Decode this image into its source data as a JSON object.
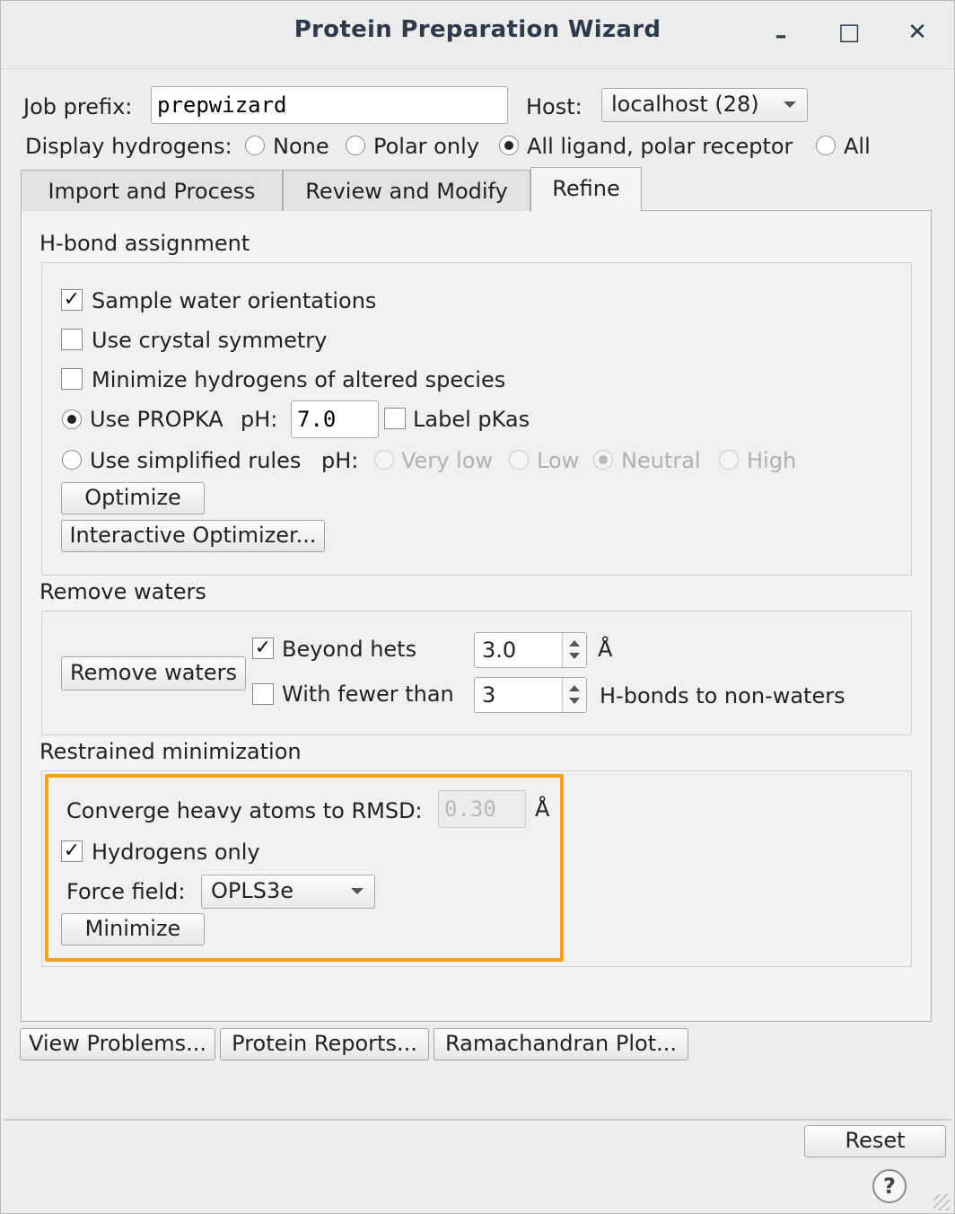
{
  "window": {
    "title": "Protein Preparation Wizard",
    "minimize_glyph": "–",
    "maximize_glyph": "□",
    "close_glyph": "✕"
  },
  "job": {
    "prefix_label": "Job prefix:",
    "prefix_value": "prepwizard",
    "host_label": "Host:",
    "host_value": "localhost (28)"
  },
  "display_hydrogens": {
    "label": "Display hydrogens:",
    "options": [
      "None",
      "Polar only",
      "All ligand, polar receptor",
      "All"
    ],
    "selected": "All ligand, polar receptor"
  },
  "tabs": [
    {
      "label": "Import and Process",
      "active": false
    },
    {
      "label": "Review and Modify",
      "active": false
    },
    {
      "label": "Refine",
      "active": true
    }
  ],
  "hbond": {
    "section_title": "H-bond assignment",
    "sample_water": {
      "label": "Sample water orientations",
      "checked": true
    },
    "crystal_symmetry": {
      "label": "Use crystal symmetry",
      "checked": false
    },
    "minimize_hydrogens": {
      "label": "Minimize hydrogens of altered species",
      "checked": false
    },
    "propka": {
      "label": "Use PROPKA",
      "selected": true,
      "ph_label": "pH:",
      "ph_value": "7.0"
    },
    "label_pkas": {
      "label": "Label pKas",
      "checked": false
    },
    "simplified": {
      "label": "Use simplified rules",
      "selected": false,
      "ph_label": "pH:"
    },
    "ph_options": [
      "Very low",
      "Low",
      "Neutral",
      "High"
    ],
    "ph_selected": "Neutral",
    "optimize_button": "Optimize",
    "interactive_button": "Interactive Optimizer..."
  },
  "waters": {
    "section_title": "Remove waters",
    "remove_button": "Remove waters",
    "beyond_hets": {
      "label": "Beyond hets",
      "checked": true,
      "value": "3.0",
      "unit": "Å"
    },
    "fewer_than": {
      "label": "With fewer than",
      "checked": false,
      "value": "3",
      "suffix": "H-bonds to non-waters"
    }
  },
  "minimization": {
    "section_title": "Restrained minimization",
    "rmsd_label": "Converge heavy atoms to RMSD:",
    "rmsd_value": "0.30",
    "rmsd_unit": "Å",
    "hydrogens_only": {
      "label": "Hydrogens only",
      "checked": true
    },
    "force_field_label": "Force field:",
    "force_field_value": "OPLS3e",
    "minimize_button": "Minimize"
  },
  "bottom_buttons": {
    "view_problems": "View Problems...",
    "protein_reports": "Protein Reports...",
    "ramachandran": "Ramachandran Plot..."
  },
  "footer": {
    "reset": "Reset",
    "help": "?"
  },
  "colors": {
    "highlight": "#f5a313",
    "title_text": "#2e3a4a"
  }
}
